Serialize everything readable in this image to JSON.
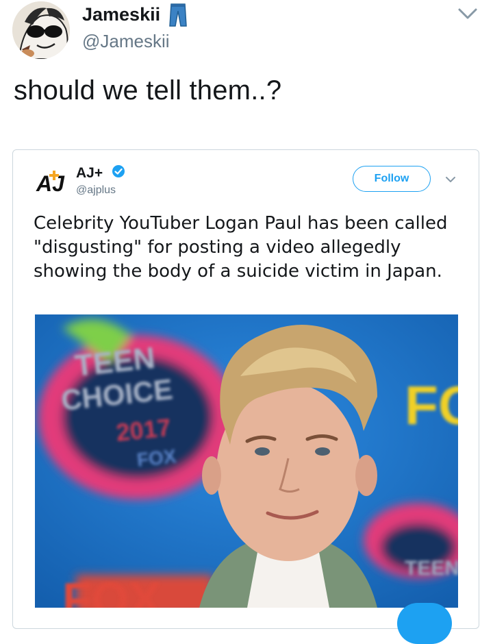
{
  "tweet": {
    "display_name": "Jameskii",
    "handle": "@Jameskii",
    "text": "should we tell them..?",
    "avatar_icon": "cartoon-avatar",
    "name_emoji_icon": "jeans-icon",
    "menu_icon": "chevron-down-icon"
  },
  "quoted": {
    "display_name": "AJ+",
    "handle": "@ajplus",
    "logo_text": "AJ",
    "verified_icon": "verified-badge-icon",
    "follow_label": "Follow",
    "menu_icon": "chevron-down-icon",
    "text": "Celebrity YouTuber Logan Paul has been called \"disgusting\" for posting a video allegedly showing the body of a suicide victim in Japan.",
    "photo": {
      "backdrop_text_1": "TEEN",
      "backdrop_text_2": "CHOICE",
      "backdrop_text_3": "2017",
      "backdrop_text_4": "FOX",
      "backdrop_text_5": "FO",
      "backdrop_text_6": "FOX",
      "backdrop_text_7": "TEEN"
    }
  },
  "colors": {
    "accent": "#1da1f2",
    "text": "#14171a",
    "muted": "#657786",
    "border": "#ccd6dd"
  }
}
